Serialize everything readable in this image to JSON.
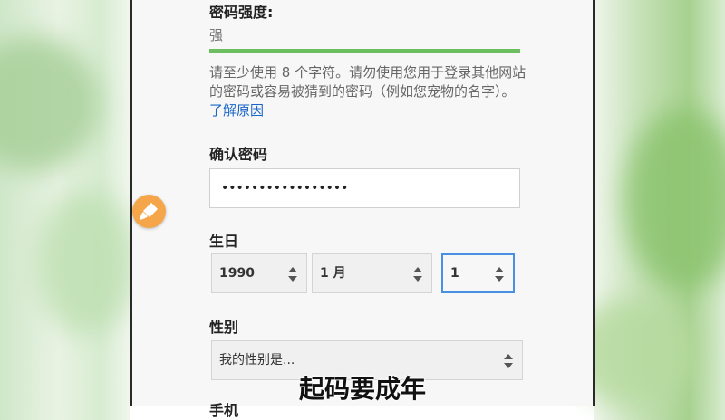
{
  "form": {
    "password_strength_label": "密码强度:",
    "password_strength_value": "强",
    "password_strength_level": 1.0,
    "help_text": "请至少使用 8 个字符。请勿使用您用于登录其他网站的密码或容易被猜到的密码（例如您宠物的名字）。",
    "help_link": "了解原因",
    "confirm_password_label": "确认密码",
    "confirm_password_value": "•••••••••••••••••",
    "birthday_label": "生日",
    "birthday_year": "1990",
    "birthday_month": "1 月",
    "birthday_day": "1",
    "gender_label": "性别",
    "gender_placeholder": "我的性别是...",
    "phone_label": "手机"
  },
  "caption": "起码要成年",
  "colors": {
    "strength_bar": "#6cbf5f",
    "link": "#1a66c7",
    "focus_border": "#4a90e2",
    "fab": "#f5a64b"
  },
  "icons": {
    "fab": "brush-icon",
    "select_arrows": "up-down-arrows-icon"
  }
}
